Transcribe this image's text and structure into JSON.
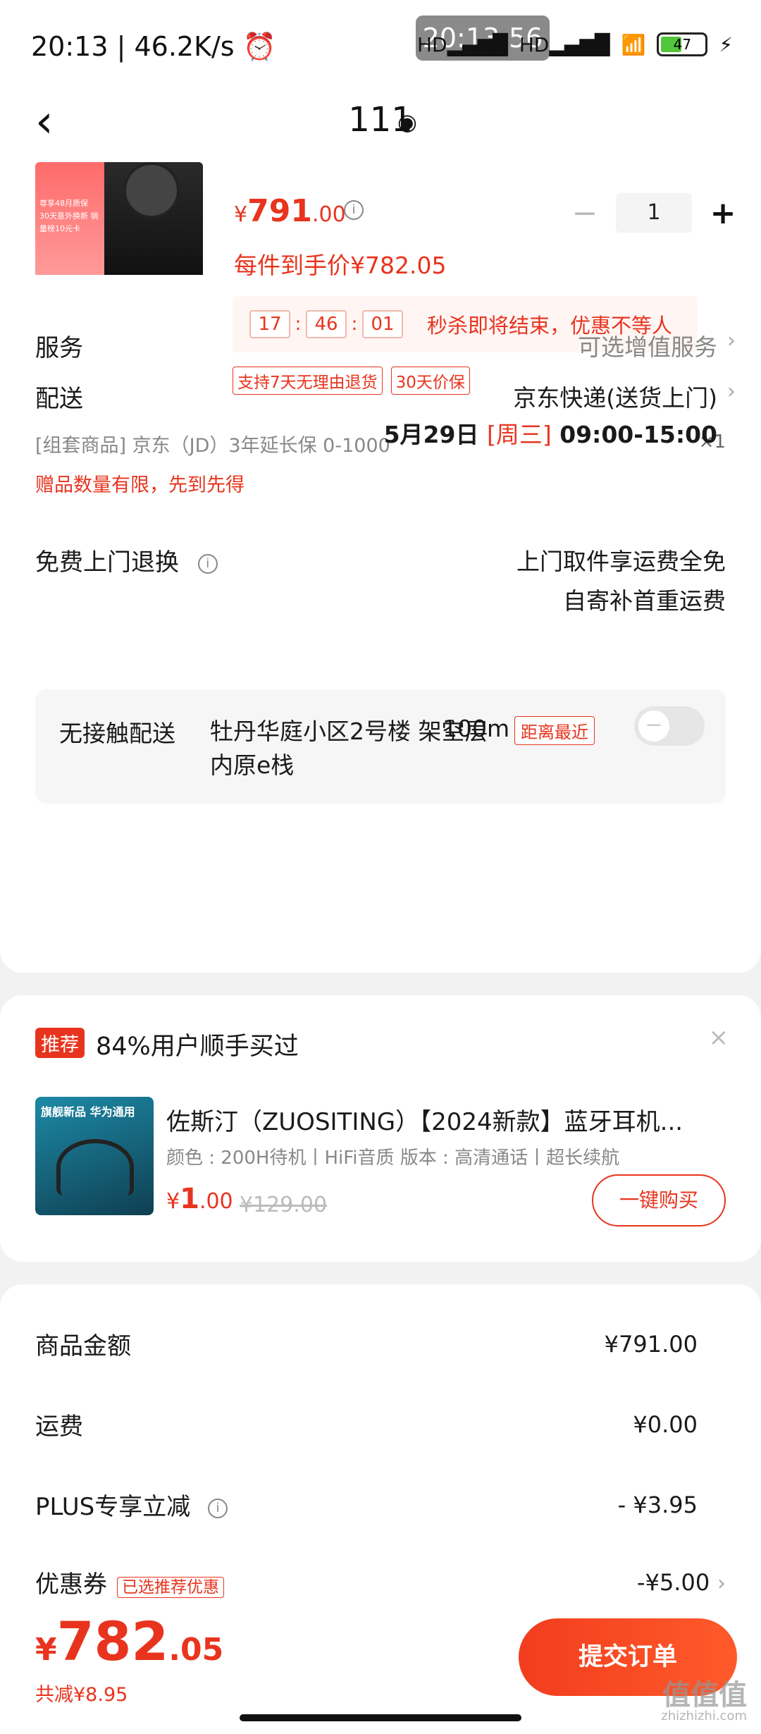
{
  "status": {
    "left": "20:13 | 46.2K/s ⏰",
    "clock_badge": "20:13:56",
    "signal1": "HD▂▄▆█",
    "signal2": "HD▂▄▆█",
    "wifi": "📶",
    "battery": "47",
    "charging": "⚡"
  },
  "nav": {
    "back": "‹",
    "title": "111",
    "pin": "◉"
  },
  "product": {
    "price_symbol": "¥",
    "price_int": "791",
    "price_dec": ".00",
    "info": "i",
    "qty_minus": "−",
    "qty_value": "1",
    "qty_plus": "+",
    "unit_price": "每件到手价¥782.05",
    "image_text": "尊享48月质保 30天意外换新 销量榜10元卡"
  },
  "flash": {
    "h": "17",
    "m": "46",
    "s": "01",
    "sep": ":",
    "text": "秒杀即将结束，优惠不等人"
  },
  "tags": [
    "支持7天无理由退货",
    "30天价保"
  ],
  "bundle": {
    "text": "[组套商品]  京东（JD）3年延长保 0-1000",
    "qty": "×1"
  },
  "gift_note": "赠品数量有限，先到先得",
  "service": {
    "label": "服务",
    "value": "可选增值服务",
    "chev": "›"
  },
  "delivery": {
    "label": "配送",
    "method": "京东快递(送货上门)",
    "chev": "›",
    "date": "5月29日",
    "weekday": "[周三]",
    "time": "09:00-15:00"
  },
  "no_contact": {
    "label": "无接触配送",
    "address": "牡丹华庭小区2号楼 架空层内原e栈",
    "distance": "100m",
    "badge": "距离最近",
    "toggle_glyph": "−"
  },
  "return": {
    "label": "免费上门退换",
    "info": "i",
    "line1": "上门取件享运费全免",
    "line2": "自寄补首重运费"
  },
  "recommend": {
    "badge": "推荐",
    "title": "84%用户顺手买过",
    "close": "×",
    "img_text": "旗舰新品  华为通用",
    "name": "佐斯汀（ZUOSITING）【2024新款】蓝牙耳机...",
    "attrs": "颜色 : 200H待机丨HiFi音质   版本 : 高清通话丨超长续航",
    "price_symbol": "¥",
    "price_int": "1",
    "price_dec": ".00",
    "orig_price": "¥129.00",
    "buy": "一键购买"
  },
  "summary": {
    "goods_label": "商品金额",
    "goods_value": "¥791.00",
    "ship_label": "运费",
    "ship_value": "¥0.00",
    "plus_label": "PLUS专享立减",
    "plus_info": "i",
    "plus_value": "- ¥3.95",
    "coupon_label": "优惠券",
    "coupon_tag": "已选推荐优惠",
    "coupon_value": "-¥5.00",
    "coupon_chev": "›"
  },
  "bottom": {
    "symbol": "¥",
    "total_int": "782",
    "total_dec": ".05",
    "saved": "共减¥8.95",
    "submit": "提交订单"
  },
  "watermark": {
    "main": "值值值",
    "sub": "zhizhizhi.com"
  }
}
